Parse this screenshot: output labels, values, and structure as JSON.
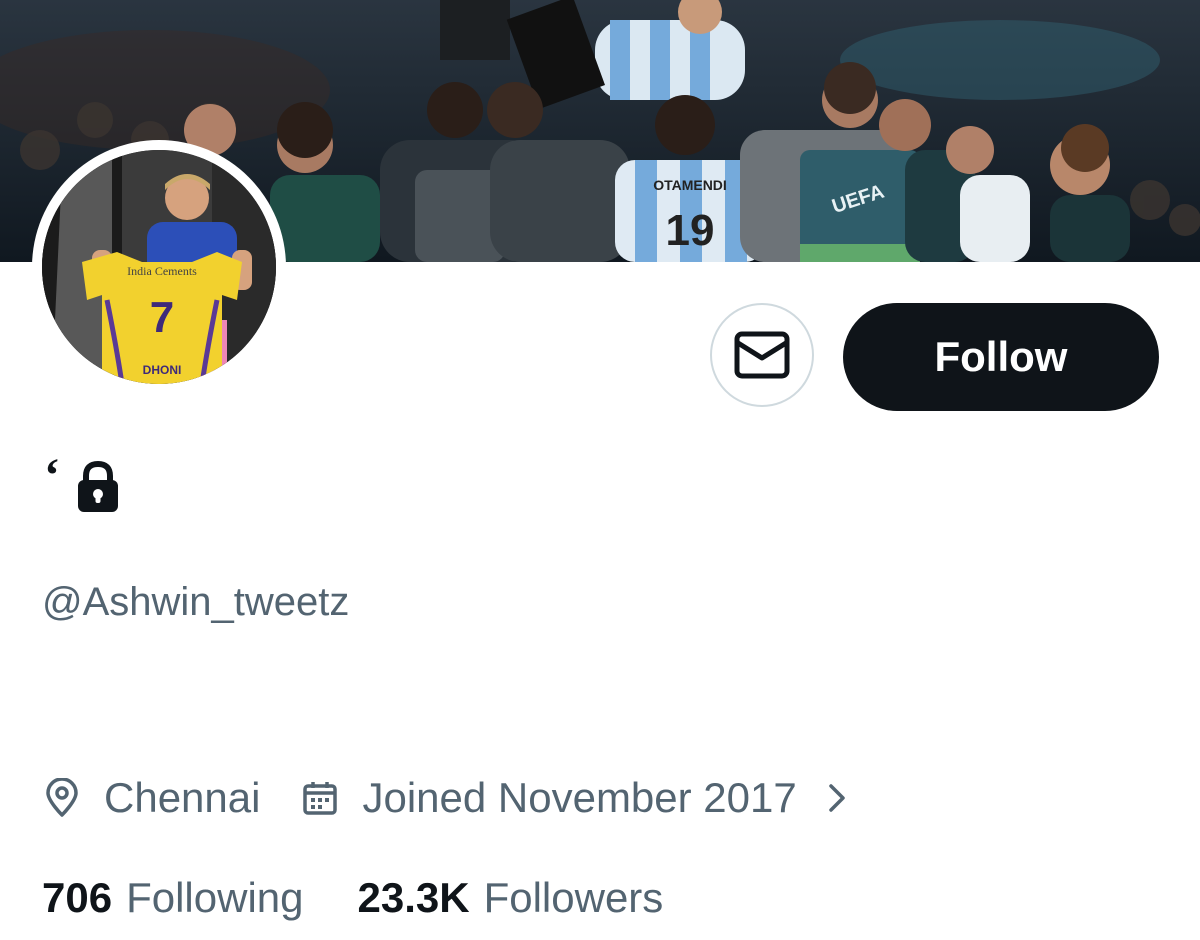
{
  "profile": {
    "display_name": "‘",
    "handle": "@Ashwin_tweetz",
    "location": "Chennai",
    "joined": "Joined November 2017",
    "following_count": "706",
    "following_label": "Following",
    "followers_count": "23.3K",
    "followers_label": "Followers"
  },
  "actions": {
    "follow_label": "Follow",
    "message_icon": "envelope-icon"
  },
  "banner": {
    "jersey_name": "OTAMENDI",
    "jersey_number": "19",
    "badge_text": "UEFA"
  },
  "avatar": {
    "shirt_sponsor": "India Cements",
    "shirt_number": "7",
    "shirt_name": "DHONI"
  },
  "icons": {
    "lock": "lock-icon",
    "location": "location-pin-icon",
    "calendar": "calendar-icon",
    "chevron": "chevron-right-icon"
  },
  "colors": {
    "primary_text": "#0f1419",
    "secondary_text": "#536471",
    "follow_bg": "#0f1419",
    "border": "#cfd9de",
    "jersey_yellow": "#f2d12e",
    "argentina_blue": "#75aadb"
  }
}
